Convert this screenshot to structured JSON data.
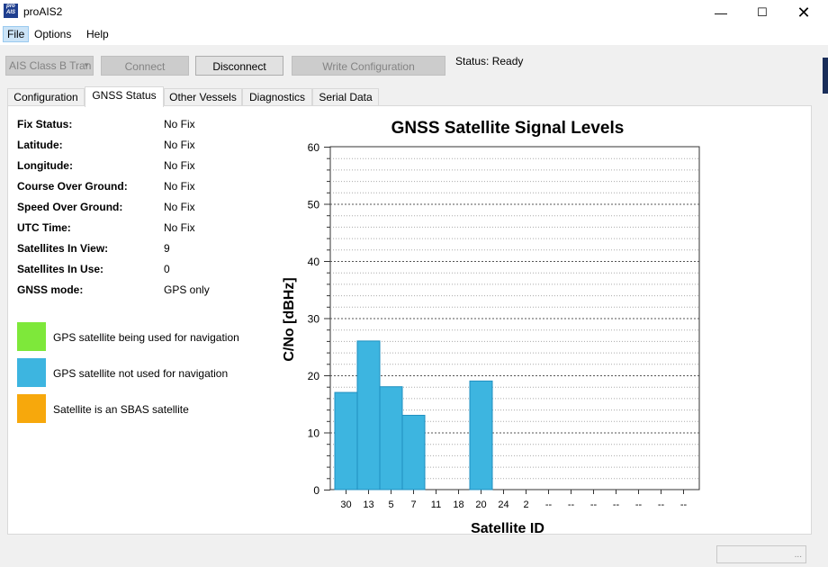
{
  "window": {
    "title": "proAIS2",
    "icon_text_top": "pro",
    "icon_text_bottom": "AIS"
  },
  "menu": [
    "File",
    "Options",
    "Help"
  ],
  "toolbar": {
    "vessel_class": "AIS Class B Tran",
    "connect": "Connect",
    "disconnect": "Disconnect",
    "write_config": "Write Configuration",
    "status": "Status: Ready"
  },
  "tabs": [
    "Configuration",
    "GNSS Status",
    "Other Vessels",
    "Diagnostics",
    "Serial Data"
  ],
  "active_tab": "GNSS Status",
  "gnss": [
    {
      "label": "Fix Status:",
      "value": "No Fix"
    },
    {
      "label": "Latitude:",
      "value": "No Fix"
    },
    {
      "label": "Longitude:",
      "value": "No Fix"
    },
    {
      "label": "Course Over Ground:",
      "value": "No Fix"
    },
    {
      "label": "Speed Over Ground:",
      "value": "No Fix"
    },
    {
      "label": "UTC Time:",
      "value": "No Fix"
    },
    {
      "label": "Satellites In View:",
      "value": "9"
    },
    {
      "label": "Satellites In Use:",
      "value": "0"
    },
    {
      "label": "GNSS mode:",
      "value": "GPS only"
    }
  ],
  "legend": [
    {
      "text": "GPS satellite being used for navigation",
      "color": "#7ee83a"
    },
    {
      "text": "GPS satellite not used for navigation",
      "color": "#3db5e0"
    },
    {
      "text": "Satellite is an SBAS satellite",
      "color": "#f7a80c"
    }
  ],
  "chart_data": {
    "type": "bar",
    "title": "GNSS Satellite Signal Levels",
    "xlabel": "Satellite ID",
    "ylabel": "C/No [dBHz]",
    "ylim": [
      0,
      60
    ],
    "yticks": [
      0,
      10,
      20,
      30,
      40,
      50,
      60
    ],
    "categories": [
      "30",
      "13",
      "5",
      "7",
      "11",
      "18",
      "20",
      "24",
      "2",
      "--",
      "--",
      "--",
      "--",
      "--",
      "--",
      "--"
    ],
    "values": [
      17,
      26,
      18,
      13,
      0,
      0,
      19,
      0,
      0,
      0,
      0,
      0,
      0,
      0,
      0,
      0
    ],
    "bar_color": "#3db5e0",
    "grid": true
  }
}
